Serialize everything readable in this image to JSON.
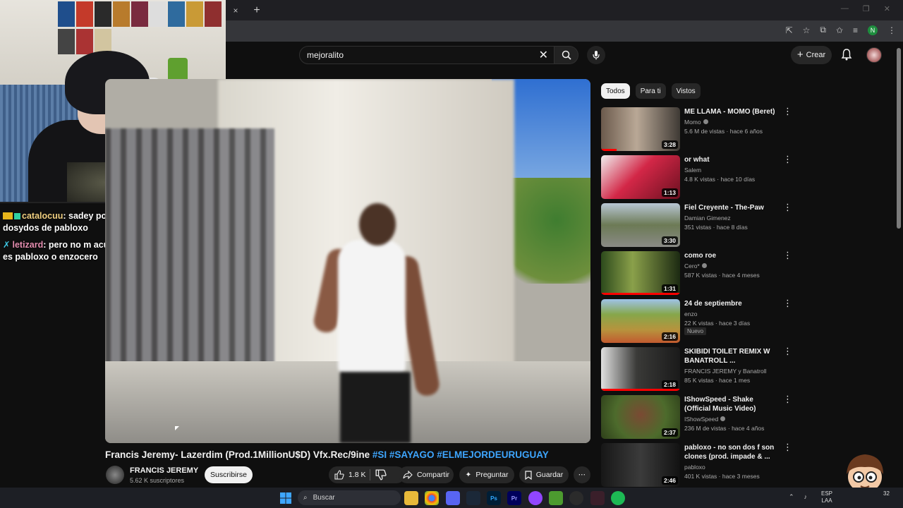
{
  "browser": {
    "tab_close": "×",
    "tab_new": "+"
  },
  "chat": [
    {
      "user": "catalocuu",
      "sep": ":",
      "text": " sadey pone dosydos de pabloxo"
    },
    {
      "user": "letizard",
      "sep": ":",
      "text": " pero no m acuerdo si es pabloxo o enzocero"
    }
  ],
  "search": {
    "query": "mejoralito"
  },
  "header": {
    "create_label": "Crear"
  },
  "video": {
    "title": "Francis Jeremy- Lazerdim (Prod.1MillionU$D) Vfx.Rec/9ine",
    "tags": [
      "#SI",
      "#SAYAGO",
      "#ELMEJORDEURUGUAY"
    ],
    "channel": "FRANCIS JEREMY",
    "subscribers": "5.62 K suscriptores",
    "subscribe_label": "Suscribirse",
    "likes": "1.8 K",
    "share_label": "Compartir",
    "ask_label": "Preguntar",
    "save_label": "Guardar"
  },
  "chips": [
    "Todos",
    "Para ti",
    "Vistos"
  ],
  "recommendations": [
    {
      "title": "ME LLAMA - MOMO (Beret)",
      "channel": "Momo",
      "verified": true,
      "meta": "5.6 M de vistas · hace 6 años",
      "duration": "3:28",
      "progress": 0.2
    },
    {
      "title": "or what",
      "channel": "Salem",
      "verified": false,
      "meta": "4.8 K vistas · hace 10 días",
      "duration": "1:13",
      "progress": 0
    },
    {
      "title": "Fiel Creyente - The-Paw",
      "channel": "Damian Gimenez",
      "verified": false,
      "meta": "351 vistas · hace 8 días",
      "duration": "3:30",
      "progress": 0
    },
    {
      "title": "como roe",
      "channel": "Cero*",
      "verified": true,
      "meta": "587 K vistas · hace 4 meses",
      "duration": "1:31",
      "progress": 1.0
    },
    {
      "title": "24 de septiembre",
      "channel": "enzo",
      "verified": false,
      "meta": "22 K vistas · hace 3 días",
      "duration": "2:16",
      "progress": 0,
      "badge": "Nuevo"
    },
    {
      "title": "SKIBIDI TOILET REMIX W BANATROLL ...",
      "channel": "FRANCIS JEREMY y Banatroll",
      "verified": false,
      "meta": "85 K vistas · hace 1 mes",
      "duration": "2:18",
      "progress": 1.0
    },
    {
      "title": "IShowSpeed - Shake (Official Music Video)",
      "channel": "IShowSpeed",
      "verified": true,
      "meta": "236 M de vistas · hace 4 años",
      "duration": "2:37",
      "progress": 0
    },
    {
      "title": "pabloxo - no son dos f son clones (prod. impade & ...",
      "channel": "pabloxo",
      "verified": false,
      "meta": "401 K vistas · hace 3 meses",
      "duration": "2:46",
      "progress": 0
    }
  ],
  "taskbar": {
    "search_label": "Buscar",
    "lang_line1": "ESP",
    "lang_line2": "LAA",
    "time": "32"
  },
  "colors": {
    "accent": "#ff0000",
    "link": "#3ea6ff",
    "background": "#0f0f0f"
  }
}
